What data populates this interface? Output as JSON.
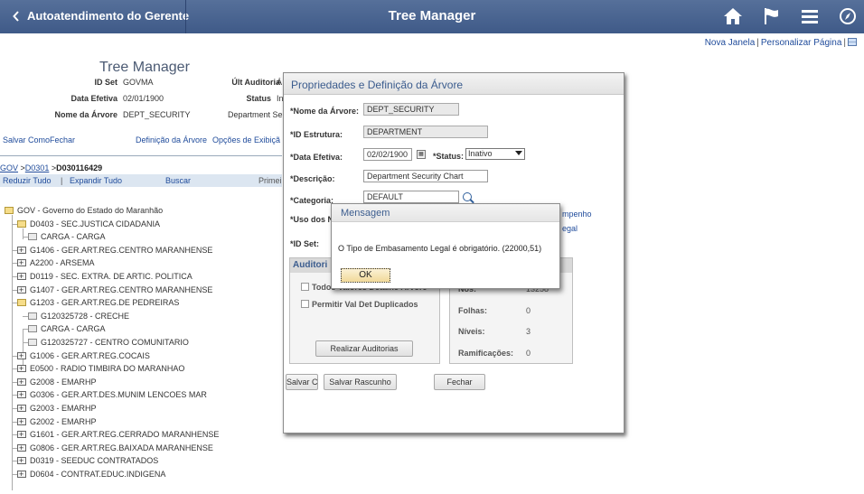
{
  "banner": {
    "back_label": "Autoatendimento do Gerente",
    "title": "Tree Manager",
    "icons": [
      "home-icon",
      "flag-icon",
      "menu-icon",
      "navbar-icon"
    ]
  },
  "top_links": {
    "new_window": "Nova Janela",
    "personalize": "Personalizar Página"
  },
  "page": {
    "title": "Tree Manager",
    "setid_label": "ID Set",
    "setid_value": "GOVMA",
    "last_audit_label": "Últ Auditoria",
    "last_audit_value": "Á",
    "eff_date_label": "Data Efetiva",
    "eff_date_value": "02/01/1900",
    "status_label": "Status",
    "status_value": "In",
    "tree_name_label": "Nome da Árvore",
    "tree_name_value": "DEPT_SECURITY",
    "department_text": "Department Se"
  },
  "actions": {
    "save_as": "Salvar Como",
    "close": "Fechar",
    "tree_def": "Definição da Árvore",
    "display_opts": "Opções de Exibiçã"
  },
  "path": {
    "l1": "GOV",
    "l2": "D0301",
    "current": "D030116429",
    "sep": ">"
  },
  "navbar": {
    "collapse": "Reduzir Tudo",
    "pipe": "|",
    "expand": "Expandir Tudo",
    "find": "Buscar",
    "first": "Primei"
  },
  "tree": [
    {
      "label": "GOV - Governo do Estado do Maranhão",
      "type": "open",
      "level": 0
    },
    {
      "label": "D0403 - SEC.JUSTICA CIDADANIA",
      "type": "open",
      "level": 1
    },
    {
      "label": "CARGA - CARGA",
      "type": "leaf",
      "level": 2
    },
    {
      "label": "G1406 - GER.ART.REG.CENTRO MARANHENSE",
      "type": "plus",
      "level": 1
    },
    {
      "label": "A2200 - ARSEMA",
      "type": "plus",
      "level": 1
    },
    {
      "label": "D0119 - SEC. EXTRA. DE ARTIC. POLITICA",
      "type": "plus",
      "level": 1
    },
    {
      "label": "G1407 - GER.ART.REG.CENTRO MARANHENSE",
      "type": "plus",
      "level": 1
    },
    {
      "label": "G1203 - GER.ART.REG.DE PEDREIRAS",
      "type": "open",
      "level": 1
    },
    {
      "label": "G120325728 - CRECHE",
      "type": "leaf",
      "level": 2
    },
    {
      "label": "CARGA - CARGA",
      "type": "leaf",
      "level": 2
    },
    {
      "label": "G120325727 - CENTRO COMUNITARIO",
      "type": "leaf",
      "level": 2
    },
    {
      "label": "G1006 - GER.ART.REG.COCAIS",
      "type": "plus",
      "level": 1
    },
    {
      "label": "E0500 - RADIO TIMBIRA DO MARANHAO",
      "type": "plus",
      "level": 1
    },
    {
      "label": "G2008 - EMARHP",
      "type": "plus",
      "level": 1
    },
    {
      "label": "G0306 - GER.ART.DES.MUNIM LENCOES MAR",
      "type": "plus",
      "level": 1
    },
    {
      "label": "G2003 - EMARHP",
      "type": "plus",
      "level": 1
    },
    {
      "label": "G2002 - EMARHP",
      "type": "plus",
      "level": 1
    },
    {
      "label": "G1601 - GER.ART.REG.CERRADO MARANHENSE",
      "type": "plus",
      "level": 1
    },
    {
      "label": "G0806 - GER.ART.REG.BAIXADA MARANHENSE",
      "type": "plus",
      "level": 1
    },
    {
      "label": "D0319 - SEEDUC CONTRATADOS",
      "type": "plus",
      "level": 1
    },
    {
      "label": "D0604 - CONTRAT.EDUC.INDIGENA",
      "type": "plus",
      "level": 1
    }
  ],
  "dialog": {
    "title": "Propriedades e Definição da Árvore",
    "tree_name_label": "*Nome da Árvore:",
    "tree_name_value": "DEPT_SECURITY",
    "structure_label": "*ID Estrutura:",
    "structure_value": "DEPARTMENT",
    "eff_date_label": "*Data Efetiva:",
    "eff_date_value": "02/02/1900",
    "status_label": "*Status:",
    "status_value": "Inativo",
    "desc_label": "*Descrição:",
    "desc_value": "Department Security Chart",
    "category_label": "*Categoria:",
    "category_value": "DEFAULT",
    "uso_label": "*Uso dos N",
    "setid_label": "*ID Set:",
    "right_link_1": "mpenho",
    "right_link_2": "egal",
    "audit_head": "Auditori",
    "chk1_label": "Todos Valores Detalhe Árvore",
    "chk2_label": "Permitir Val Det Duplicados",
    "run_audits": "Realizar Auditorias",
    "nodes_label": "Nós:",
    "nodes_value": "13258",
    "leaves_label": "Folhas:",
    "leaves_value": "0",
    "levels_label": "Níveis:",
    "levels_value": "3",
    "branches_label": "Ramificações:",
    "branches_value": "0",
    "btn_save_as": "Salvar Como",
    "btn_save_draft": "Salvar Rascunho",
    "btn_close": "Fechar"
  },
  "message": {
    "title": "Mensagem",
    "text": "O Tipo de Embasamento Legal é obrigatório. (22000,51)",
    "ok": "OK"
  }
}
